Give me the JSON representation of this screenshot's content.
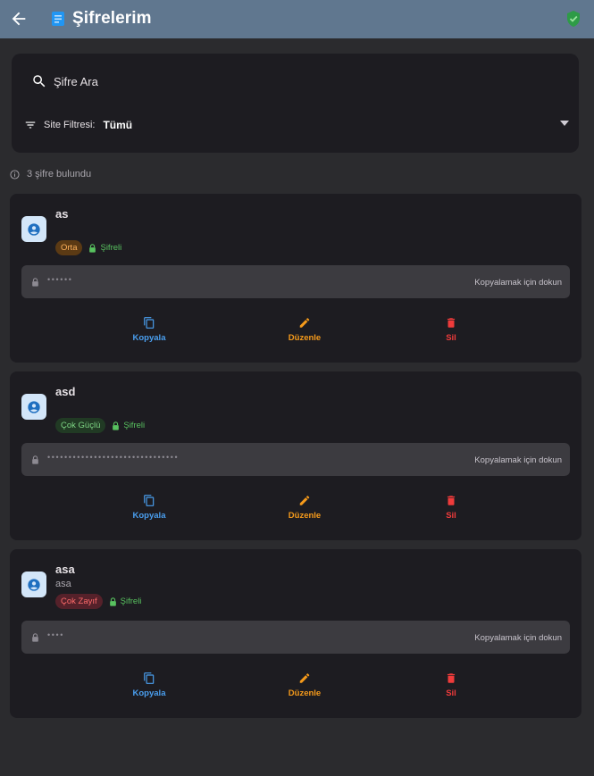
{
  "header": {
    "title": "Şifrelerim"
  },
  "search": {
    "placeholder": "Şifre Ara",
    "value": ""
  },
  "filter": {
    "label": "Site Filtresi:",
    "value": "Tümü"
  },
  "summary": {
    "count_text": "3 şifre bulundu"
  },
  "colors": {
    "appbar": "#60778f",
    "background": "#2b2b2e",
    "card": "#1d1c21",
    "copy": "#4a9ff0",
    "edit": "#f59a1b",
    "delete": "#ef3b3b",
    "encrypted": "#58c25f"
  },
  "passwords": [
    {
      "site": "as",
      "username": "",
      "strength": "Orta",
      "strength_color": "orange",
      "encrypted_label": "Şifreli",
      "masked": "••••••",
      "copy_hint": "Kopyalamak için dokun",
      "actions": {
        "copy": "Kopyala",
        "edit": "Düzenle",
        "delete": "Sil"
      }
    },
    {
      "site": "asd",
      "username": "",
      "strength": "Çok Güçlü",
      "strength_color": "green",
      "encrypted_label": "Şifreli",
      "masked": "•••••••••••••••••••••••••••••••",
      "copy_hint": "Kopyalamak için dokun",
      "actions": {
        "copy": "Kopyala",
        "edit": "Düzenle",
        "delete": "Sil"
      }
    },
    {
      "site": "asa",
      "username": "asa",
      "strength": "Çok Zayıf",
      "strength_color": "red",
      "encrypted_label": "Şifreli",
      "masked": "••••",
      "copy_hint": "Kopyalamak için dokun",
      "actions": {
        "copy": "Kopyala",
        "edit": "Düzenle",
        "delete": "Sil"
      }
    }
  ],
  "icons": [
    "back-arrow-icon",
    "key-icon",
    "shield-icon",
    "search-icon",
    "filter-icon",
    "dropdown-arrow-icon",
    "info-icon",
    "account-icon",
    "lock-icon",
    "copy-icon",
    "edit-icon",
    "delete-icon"
  ]
}
